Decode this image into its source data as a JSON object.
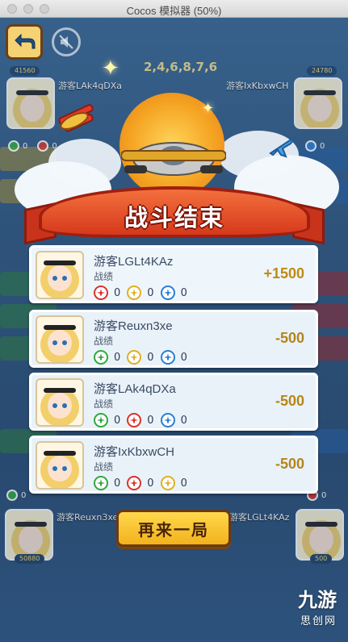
{
  "window": {
    "title": "Cocos 模拟器 (50%)"
  },
  "top_score": "2,4,6,8,7,6",
  "corner_players": {
    "top_left": {
      "name": "游客LAk4qDXa",
      "coins": "41560",
      "stats": [
        "0",
        "0"
      ]
    },
    "top_right": {
      "name": "游客IxKbxwCH",
      "coins": "24780",
      "stats": [
        "0"
      ]
    },
    "bottom_left": {
      "name": "游客Reuxn3xe",
      "coins": "50880",
      "stats": [
        "0"
      ]
    },
    "bottom_right": {
      "name": "游客LGLt4KAz",
      "coins": "500",
      "stats": [
        "0"
      ]
    }
  },
  "banner": {
    "title": "战斗结束"
  },
  "results": [
    {
      "name": "游客LGLt4KAz",
      "subtitle": "战绩",
      "score": "+1500",
      "stats": [
        {
          "icon": "red-plane-icon",
          "color": "#d9322b",
          "value": "0"
        },
        {
          "icon": "yellow-plane-icon",
          "color": "#e0b020",
          "value": "0"
        },
        {
          "icon": "blue-plane-icon",
          "color": "#2b7fd2",
          "value": "0"
        }
      ]
    },
    {
      "name": "游客Reuxn3xe",
      "subtitle": "战绩",
      "score": "-500",
      "stats": [
        {
          "icon": "green-plane-icon",
          "color": "#2fa83c",
          "value": "0"
        },
        {
          "icon": "yellow-plane-icon",
          "color": "#e0b020",
          "value": "0"
        },
        {
          "icon": "blue-plane-icon",
          "color": "#2b7fd2",
          "value": "0"
        }
      ]
    },
    {
      "name": "游客LAk4qDXa",
      "subtitle": "战绩",
      "score": "-500",
      "stats": [
        {
          "icon": "green-plane-icon",
          "color": "#2fa83c",
          "value": "0"
        },
        {
          "icon": "red-plane-icon",
          "color": "#d9322b",
          "value": "0"
        },
        {
          "icon": "blue-plane-icon",
          "color": "#2b7fd2",
          "value": "0"
        }
      ]
    },
    {
      "name": "游客IxKbxwCH",
      "subtitle": "战绩",
      "score": "-500",
      "stats": [
        {
          "icon": "green-plane-icon",
          "color": "#2fa83c",
          "value": "0"
        },
        {
          "icon": "red-plane-icon",
          "color": "#d9322b",
          "value": "0"
        },
        {
          "icon": "yellow-plane-icon",
          "color": "#e0b020",
          "value": "0"
        }
      ]
    }
  ],
  "actions": {
    "play_again": "再来一局"
  },
  "watermark": {
    "top": "九游",
    "bottom": "思创网"
  },
  "colors": {
    "accent": "#f2b21c",
    "banner": "#d6391c",
    "positive_score": "#c08b12",
    "negative_score": "#b6851c"
  }
}
